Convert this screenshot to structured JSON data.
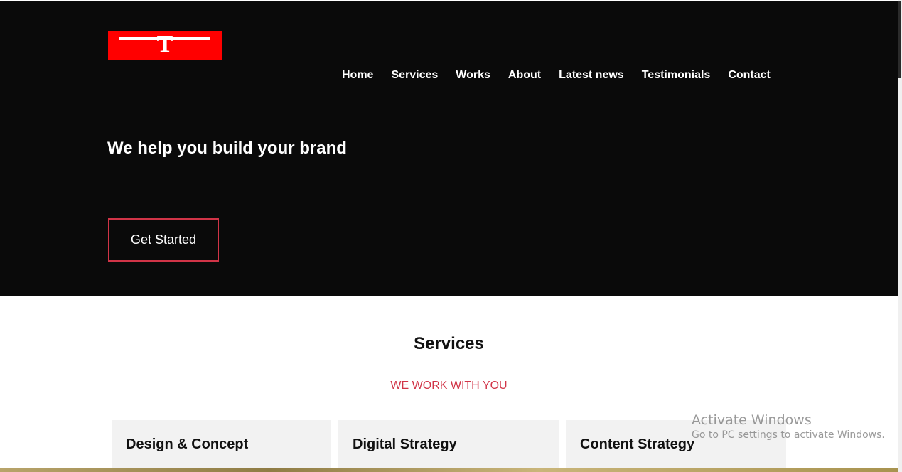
{
  "brand": {
    "logo_letter": "T",
    "accent": "#ff0000",
    "cta_border": "#d13447"
  },
  "nav": {
    "items": [
      {
        "label": "Home"
      },
      {
        "label": "Services"
      },
      {
        "label": "Works"
      },
      {
        "label": "About"
      },
      {
        "label": "Latest news"
      },
      {
        "label": "Testimonials"
      },
      {
        "label": "Contact"
      }
    ]
  },
  "hero": {
    "headline": "We help you build your brand",
    "cta_label": "Get Started"
  },
  "services": {
    "title": "Services",
    "subtitle": "WE WORK WITH YOU",
    "subtitle_color": "#d13447",
    "cards": [
      {
        "title": "Design & Concept"
      },
      {
        "title": "Digital Strategy"
      },
      {
        "title": "Content Strategy"
      }
    ]
  },
  "os_overlay": {
    "line1": "Activate Windows",
    "line2": "Go to PC settings to activate Windows."
  }
}
